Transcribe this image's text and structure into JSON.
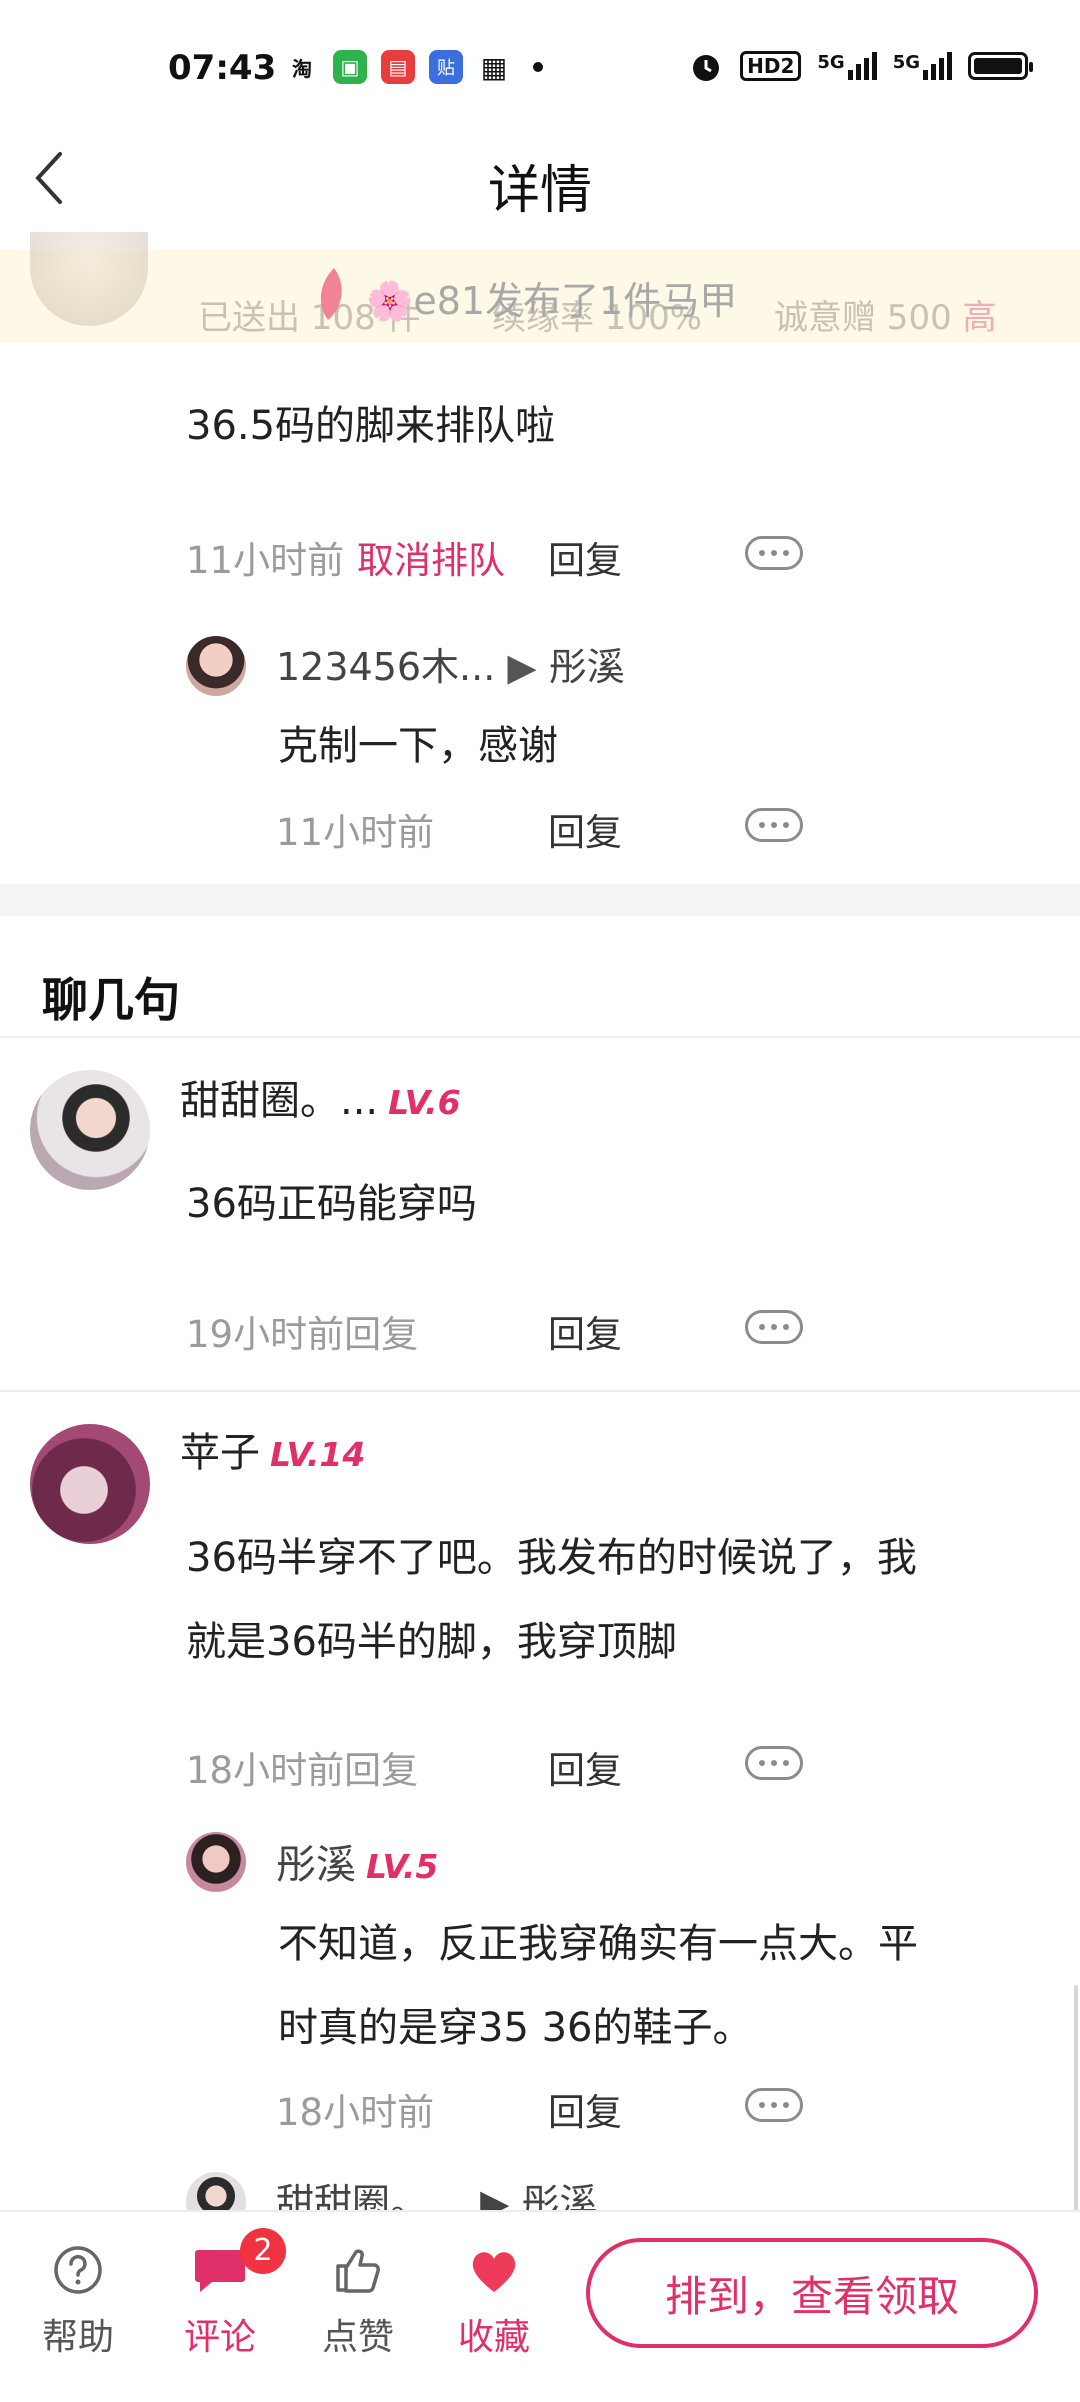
{
  "status_bar": {
    "time": "07:43",
    "apps": [
      {
        "icon": "taobao-icon",
        "glyph": "淘",
        "color": "#111111"
      },
      {
        "icon": "wechat-icon",
        "glyph": "▣",
        "color": "#2fb24c"
      },
      {
        "icon": "red-app-icon",
        "glyph": "▤",
        "color": "#e83d3d"
      },
      {
        "icon": "tieba-icon",
        "glyph": "贴",
        "color": "#3b6fe0"
      },
      {
        "icon": "gift-icon",
        "glyph": "🎁",
        "color": "#111111"
      }
    ],
    "right_labels": {
      "hd": "HD2",
      "sig1": "5G",
      "sig2": "5G"
    }
  },
  "header": {
    "title": "详情"
  },
  "banner": {
    "stat_sent": "已送出 108 件",
    "stat_rate": "续缘率 100%",
    "stat_gift": "诚意赠 500",
    "stat_gift_hi": "高",
    "message": "🌸e81发布了1件马甲"
  },
  "queue_comment": {
    "text": "36.5码的脚来排队啦",
    "time": "11小时前",
    "cancel": "取消排队",
    "reply": "回复",
    "sub": {
      "user": "123456木...",
      "arrow": "▶",
      "to": "彤溪",
      "text": "克制一下，感谢",
      "time": "11小时前",
      "reply": "回复"
    }
  },
  "chat_section": {
    "title": "聊几句"
  },
  "comments": [
    {
      "name": "甜甜圈。...",
      "level": "LV.6",
      "text": "36码正码能穿吗",
      "time": "19小时前回复",
      "reply": "回复"
    },
    {
      "name": "苹子",
      "level": "LV.14",
      "text_line1": "36码半穿不了吧。我发布的时候说了，我",
      "text_line2": "就是36码半的脚，我穿顶脚",
      "time": "18小时前回复",
      "reply": "回复",
      "sub": {
        "name": "彤溪",
        "level": "LV.5",
        "text_line1": "不知道，反正我穿确实有一点大。平",
        "text_line2": "时真的是穿35 36的鞋子。",
        "time": "18小时前",
        "reply": "回复"
      },
      "next_sub": {
        "name": "甜甜圈。",
        "arrow": "▶",
        "to": "彤溪"
      }
    }
  ],
  "bottom_bar": {
    "help": "帮助",
    "comment": "评论",
    "comment_badge": "2",
    "like": "点赞",
    "favorite": "收藏",
    "cta": "排到，查看领取"
  },
  "colors": {
    "accent": "#e12f6a",
    "banner_bg": "#fdf9e6",
    "badge": "#ef3340"
  }
}
